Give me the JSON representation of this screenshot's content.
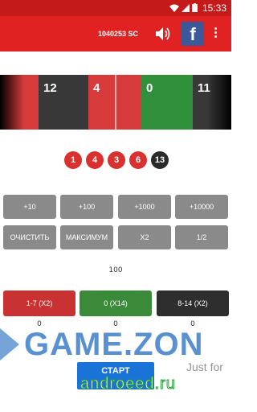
{
  "status_bar": {
    "time": "15:33",
    "icons": [
      "wifi-icon",
      "signal-icon",
      "battery-icon"
    ]
  },
  "app_bar": {
    "balance": "1040253 SC",
    "sound_icon": "speaker-icon",
    "facebook_icon": "facebook-icon",
    "facebook_label": "f",
    "more_icon": "more-vert-icon"
  },
  "strip": {
    "cells": [
      {
        "label": "",
        "color": "red"
      },
      {
        "label": "12",
        "color": "black"
      },
      {
        "label": "4",
        "color": "red"
      },
      {
        "label": "0",
        "color": "green"
      },
      {
        "label": "11",
        "color": "black"
      }
    ]
  },
  "history": [
    {
      "number": "1",
      "color": "red"
    },
    {
      "number": "4",
      "color": "red"
    },
    {
      "number": "3",
      "color": "red"
    },
    {
      "number": "6",
      "color": "red"
    },
    {
      "number": "13",
      "color": "black"
    }
  ],
  "amount_buttons": [
    "+10",
    "+100",
    "+1000",
    "+10000"
  ],
  "action_buttons": [
    "ОЧИСТИТЬ",
    "МАКСИМУМ",
    "X2",
    "1/2"
  ],
  "bet_amount": "100",
  "bet_options": [
    {
      "label": "1-7 (X2)",
      "sum": "0",
      "color": "#c93232"
    },
    {
      "label": "0 (X14)",
      "sum": "0",
      "color": "#3a8a3a"
    },
    {
      "label": "8-14 (X2)",
      "sum": "0",
      "color": "#2e2e2e"
    }
  ],
  "start_button": "СТАРТ",
  "watermark": {
    "main": "GAME.ZON",
    "sub": "Just for",
    "site": "androeed.ru"
  }
}
